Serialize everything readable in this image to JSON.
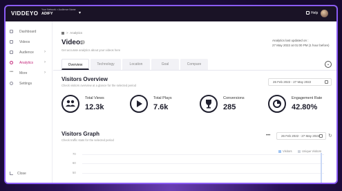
{
  "app": {
    "logo": "VIDDEYO",
    "account_subtitle": "Your Network > Audience Name",
    "account_name": "ADIFY",
    "help_label": "Help"
  },
  "sidebar": {
    "items": [
      {
        "label": "Dashboard",
        "icon": "dashboard-icon"
      },
      {
        "label": "Videos",
        "icon": "video-icon"
      },
      {
        "label": "Audience",
        "icon": "audience-icon",
        "chevron": "›"
      },
      {
        "label": "Analytics",
        "icon": "analytics-icon",
        "chevron": "›",
        "active": true
      },
      {
        "label": "More",
        "icon": "more-icon",
        "chevron": "›"
      },
      {
        "label": "Settings",
        "icon": "settings-icon"
      }
    ],
    "close_label": "Close"
  },
  "header": {
    "breadcrumb": "Analytics",
    "title": "Videos",
    "subtitle": "Get accurate analytics about your videos here",
    "updated_line1": "Analytics last updated on :",
    "updated_line2": "27 May 2022 at 01:00 PM (1 hour before)"
  },
  "tabs": [
    "Overview",
    "Technology",
    "Location",
    "Goal",
    "Compare"
  ],
  "overview": {
    "title": "Visitors Overview",
    "subtitle": "Check visitors overview at a glance for the selected period",
    "date_range": "26 Feb 2022 - 27 May 2022",
    "metrics": [
      {
        "label": "Total Views",
        "value": "12.3k",
        "icon": "users-icon"
      },
      {
        "label": "Total Plays",
        "value": "7.6k",
        "icon": "play-icon"
      },
      {
        "label": "Conversions",
        "value": "285",
        "icon": "trophy-icon"
      },
      {
        "label": "Engagement Rate",
        "value": "42.80%",
        "icon": "pie-icon"
      }
    ]
  },
  "graph": {
    "title": "Visitors Graph",
    "subtitle": "Check traffic stats for the selected period",
    "date_range": "26 Feb 2022 - 27 May 2022",
    "legend": [
      "Visitors",
      "Unique Visitors"
    ],
    "yticks": [
      "70",
      "60",
      "50"
    ]
  },
  "colors": {
    "accent": "#c2267a",
    "dark": "#1a1326",
    "frame": "#8b5cf6"
  }
}
